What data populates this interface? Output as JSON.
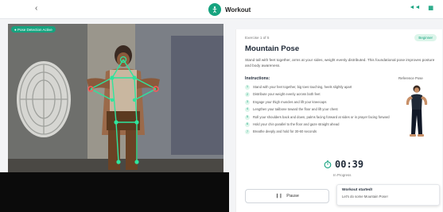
{
  "header": {
    "back_icon": "chevron-left-icon",
    "back_label": "‹",
    "app_icon": "activity-icon",
    "title": "Workout",
    "action_1": "◄◄",
    "action_2": "▦"
  },
  "camera": {
    "badge": "● Pose Detection Active"
  },
  "pose": {
    "crumb": "Exercise 1 of 5",
    "difficulty": "Beginner",
    "title": "Mountain Pose",
    "description": "Stand tall with feet together, arms at your sides, weight evenly distributed. This foundational pose improves posture and body awareness.",
    "instructions_title": "Instructions:",
    "steps": [
      "Stand with your feet together, big toes touching, heels slightly apart",
      "Distribute your weight evenly across both feet",
      "Engage your thigh muscles and lift your kneecaps",
      "Lengthen your tailbone toward the floor and lift your chest",
      "Roll your shoulders back and down, palms facing forward at sides or in prayer facing forward",
      "Hold your chin parallel to the floor and gaze straight ahead",
      "Breathe deeply and hold for 30-60 seconds"
    ],
    "reference_label": "Reference Pose"
  },
  "timer": {
    "value": "00:39",
    "status": "In Progress"
  },
  "controls": {
    "pause_label": "Pause"
  },
  "toast": {
    "title": "Workout started!",
    "message": "Let's do some Mountain Pose!"
  },
  "colors": {
    "accent": "#16a37f",
    "skeleton": "#2ee59d",
    "keypoint_red": "#ff5a5a"
  }
}
